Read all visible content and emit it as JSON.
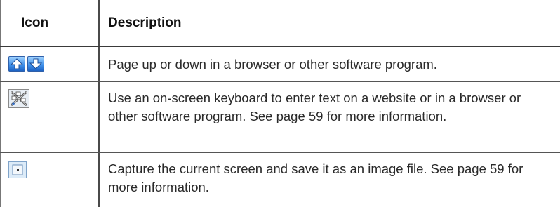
{
  "table": {
    "headers": {
      "icon": "Icon",
      "description": "Description"
    },
    "rows": [
      {
        "icon": "page-up-down-icon",
        "description": "Page up or down in a browser or other software program."
      },
      {
        "icon": "on-screen-keyboard-icon",
        "description": "Use an on-screen keyboard to enter text on a website or in a browser or other software program. See page 59 for more information."
      },
      {
        "icon": "screen-capture-icon",
        "description": "Capture the current screen and save it as an image file. See page 59 for more information."
      }
    ]
  },
  "colors": {
    "rule": "#4a4a4a",
    "text": "#2a2a2a",
    "icon_blue": "#3d8ee8"
  }
}
